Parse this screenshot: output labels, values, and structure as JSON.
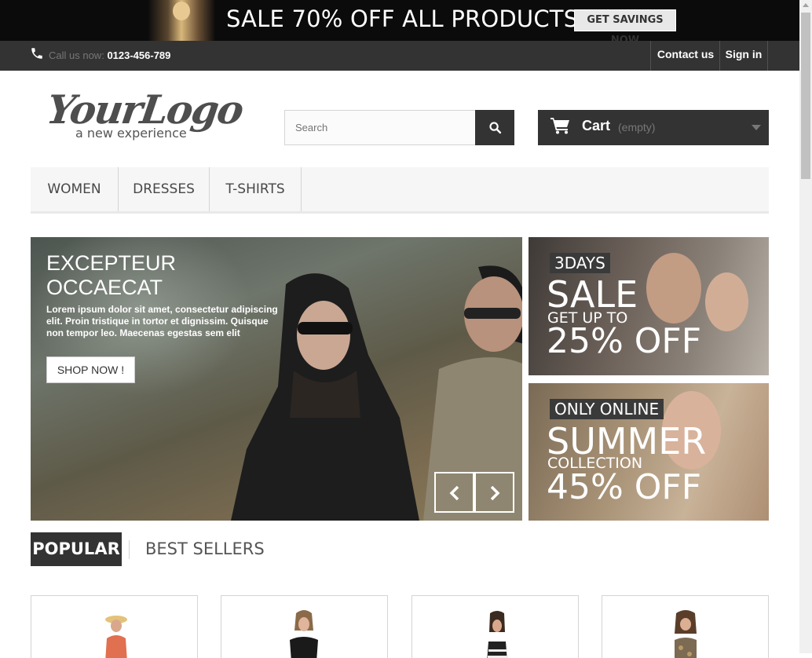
{
  "promo_banner": {
    "headline": "SALE 70% OFF ALL PRODUCTS",
    "cta_label": "GET SAVINGS NOW"
  },
  "topbar": {
    "call_label": "Call us now:",
    "phone": "0123-456-789",
    "contact_label": "Contact us",
    "signin_label": "Sign in"
  },
  "header": {
    "logo_text": "YourLogo",
    "logo_tagline": "a new experience",
    "search_placeholder": "Search",
    "cart_label": "Cart",
    "cart_status": "(empty)"
  },
  "menu": {
    "items": [
      "WOMEN",
      "DRESSES",
      "T-SHIRTS"
    ]
  },
  "slider": {
    "title_line1": "EXCEPTEUR",
    "title_line2": "OCCAECAT",
    "description": "Lorem ipsum dolor sit amet, consectetur adipiscing elit. Proin tristique in tortor et dignissim. Quisque non tempor leo. Maecenas egestas sem elit",
    "button_label": "SHOP NOW !"
  },
  "promo_tiles": [
    {
      "tag": "3DAYS",
      "big": "SALE",
      "mid": "GET UP TO",
      "pct": "25% OFF"
    },
    {
      "tag": "ONLY ONLINE",
      "big": "SUMMER",
      "mid": "COLLECTION",
      "pct": "45% OFF"
    }
  ],
  "product_tabs": {
    "active": "POPULAR",
    "inactive": "BEST SELLERS"
  },
  "colors": {
    "dark": "#333333",
    "light_bg": "#f6f6f6",
    "border": "#d6d4d4"
  }
}
